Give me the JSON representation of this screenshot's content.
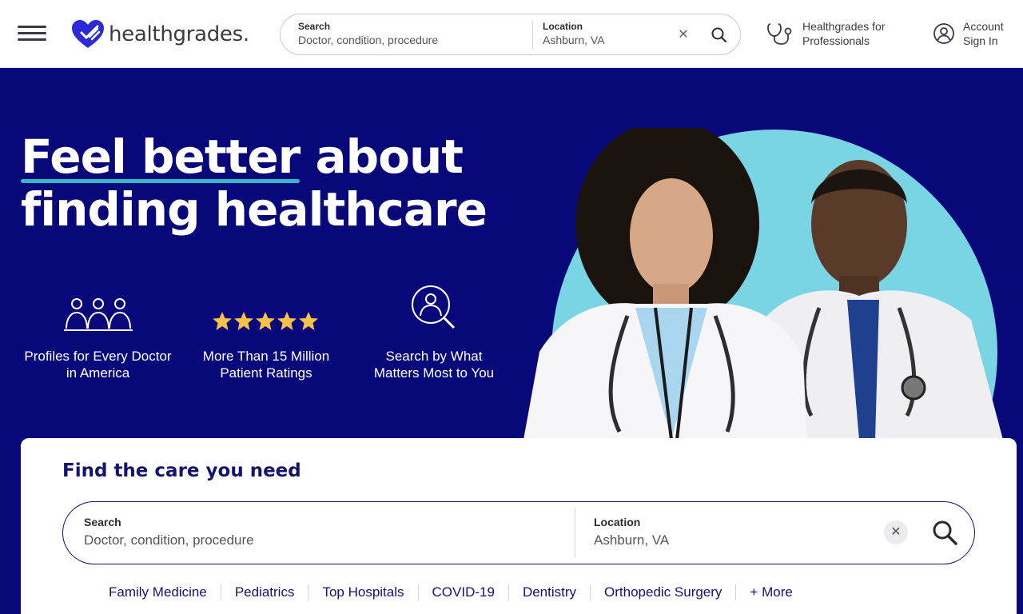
{
  "header": {
    "logo_text": "healthgrades.",
    "search": {
      "label": "Search",
      "placeholder": "Doctor, condition, procedure",
      "location_label": "Location",
      "location_value": "Ashburn, VA"
    },
    "professionals_line1": "Healthgrades for",
    "professionals_line2": "Professionals",
    "account_line1": "Account",
    "account_line2": "Sign In"
  },
  "hero": {
    "title_underlined": "Feel better",
    "title_rest": " about",
    "title_line2": "finding healthcare",
    "features": [
      {
        "icon": "doctors-group-icon",
        "line1": "Profiles for Every Doctor",
        "line2": "in America"
      },
      {
        "icon": "five-stars-icon",
        "line1": "More Than 15 Million",
        "line2": "Patient Ratings"
      },
      {
        "icon": "search-doctor-icon",
        "line1": "Search by What",
        "line2": "Matters Most to You"
      }
    ]
  },
  "card": {
    "title": "Find the care you need",
    "search": {
      "label": "Search",
      "placeholder": "Doctor, condition, procedure",
      "location_label": "Location",
      "location_value": "Ashburn, VA"
    },
    "quick_links": [
      "Family Medicine",
      "Pediatrics",
      "Top Hospitals",
      "COVID-19",
      "Dentistry",
      "Orthopedic Surgery",
      "+ More"
    ]
  },
  "colors": {
    "hero_bg": "#08087a",
    "accent_teal": "#39b6c6",
    "circle": "#79d4e3",
    "brand_blue": "#2a2ad6",
    "star": "#f7c24b"
  }
}
